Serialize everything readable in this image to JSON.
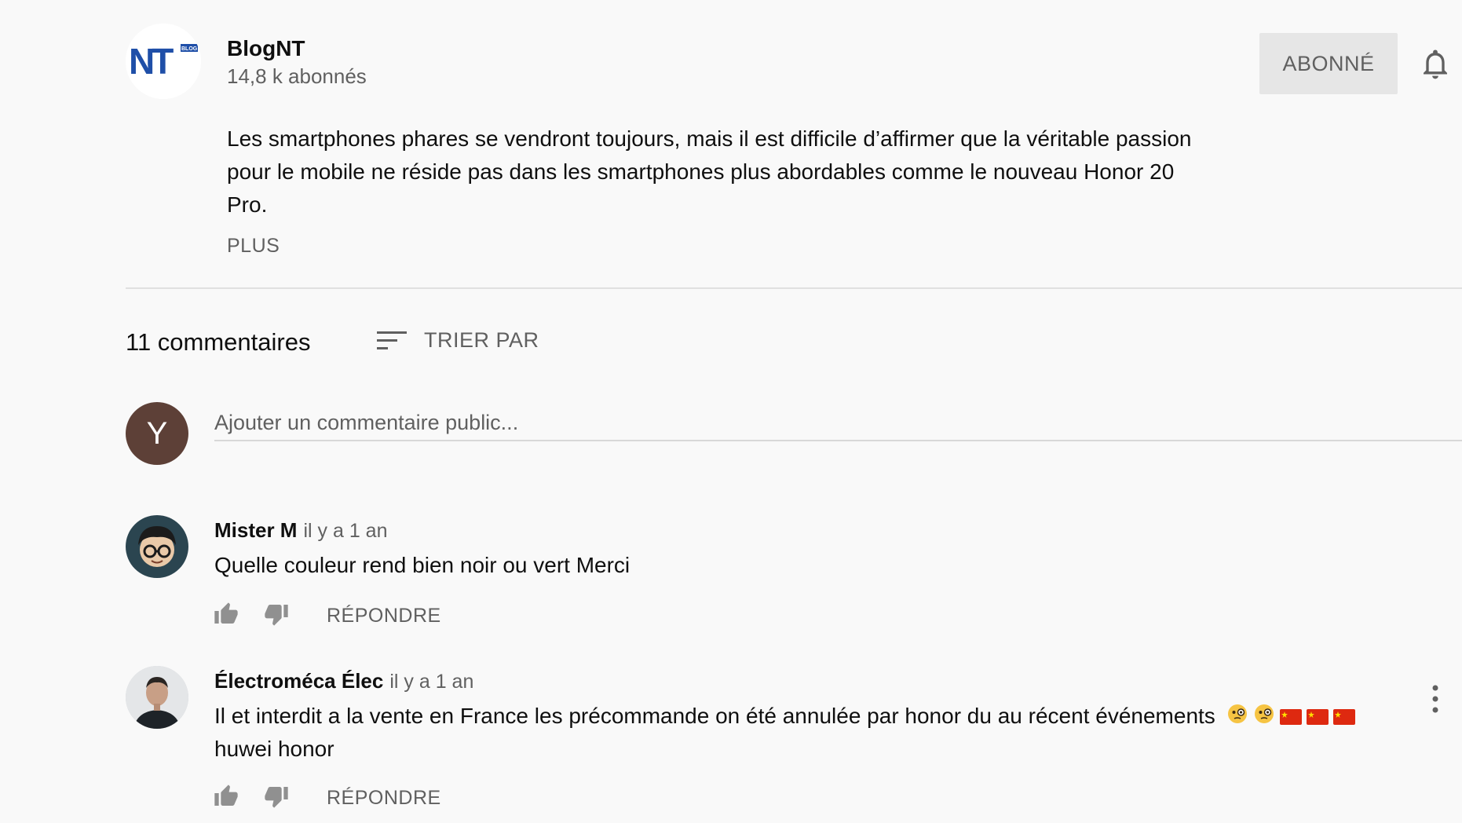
{
  "channel": {
    "name": "BlogNT",
    "subscribers": "14,8 k abonnés",
    "logo_text": "NT",
    "logo_badge": "BLOG",
    "subscribe_label": "ABONNÉ",
    "accent": "#1f4fa8"
  },
  "video": {
    "description": "Les smartphones phares se vendront toujours, mais il est difficile d’affirmer que la véritable passion pour le mobile ne réside pas dans les smartphones plus abordables comme le nouveau Honor 20 Pro.",
    "more_label": "PLUS"
  },
  "comments_section": {
    "count_label": "11 commentaires",
    "sort_label": "TRIER PAR",
    "user_initial": "Y",
    "input_placeholder": "Ajouter un commentaire public..."
  },
  "comments": [
    {
      "author": "Mister M",
      "time": "il y a 1 an",
      "text": "Quelle couleur rend bien noir ou vert Merci",
      "reply_label": "RÉPONDRE"
    },
    {
      "author": "Électroméca Élec",
      "time": "il y a 1 an",
      "text": "Il et interdit a la vente en France les précommande on été annulée par honor du au récent événements",
      "text_emojis": [
        "face-with-monocle",
        "face-with-monocle",
        "flag-china",
        "flag-china",
        "flag-china"
      ],
      "text_line2": "huwei honor",
      "reply_label": "RÉPONDRE"
    }
  ],
  "icons": {
    "bell": "bell-icon",
    "sort": "sort-icon",
    "like": "thumb-up-icon",
    "dislike": "thumb-down-icon",
    "menu": "more-vert-icon"
  }
}
